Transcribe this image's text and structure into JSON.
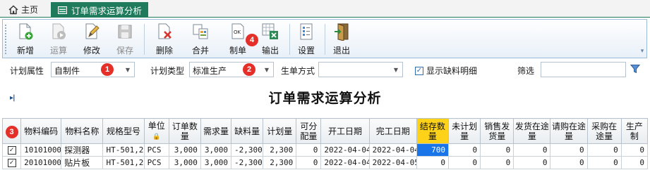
{
  "tabs": {
    "home_label": "主页",
    "active_label": "订单需求运算分析"
  },
  "toolbar": {
    "buttons": [
      {
        "label": "新增",
        "icon": "new-icon",
        "enabled": true
      },
      {
        "label": "运算",
        "icon": "compute-icon",
        "enabled": false
      },
      {
        "label": "修改",
        "icon": "edit-icon",
        "enabled": true
      },
      {
        "label": "保存",
        "icon": "save-icon",
        "enabled": false
      },
      {
        "label": "删除",
        "icon": "delete-icon",
        "enabled": true
      },
      {
        "label": "合并",
        "icon": "merge-icon",
        "enabled": true
      },
      {
        "label": "制单",
        "icon": "make-order-icon",
        "enabled": true
      },
      {
        "label": "输出",
        "icon": "export-icon",
        "enabled": true
      },
      {
        "label": "设置",
        "icon": "settings-icon",
        "enabled": true
      },
      {
        "label": "退出",
        "icon": "exit-icon",
        "enabled": true
      }
    ]
  },
  "filters": {
    "plan_attr_label": "计划属性",
    "plan_attr_value": "自制件",
    "plan_type_label": "计划类型",
    "plan_type_value": "标准生产",
    "production_mode_label": "生单方式",
    "production_mode_value": "",
    "show_shortage_label": "显示缺料明细",
    "show_shortage_checked": true,
    "filter_label": "筛选",
    "filter_value": ""
  },
  "badges": {
    "b1": "1",
    "b2": "2",
    "b3": "3",
    "b4": "4"
  },
  "report": {
    "collapse_glyph": "▸|",
    "title": "订单需求运算分析"
  },
  "grid": {
    "columns": [
      "物料编码",
      "物料名称",
      "规格型号",
      "单位",
      "订单数量",
      "需求量",
      "缺料量",
      "计划量",
      "可分配量",
      "开工日期",
      "完工日期",
      "结存数量",
      "未计划量",
      "销售发货量",
      "发货在途量",
      "请购在途量",
      "采购在途量",
      "生产制"
    ],
    "rows": [
      {
        "checked": true,
        "code": "10101000",
        "name": "探测器",
        "spec": "HT-501,2",
        "unit": "PCS",
        "order_qty": "3,000",
        "demand": "3,000",
        "shortage": "-2,300",
        "plan_qty": "2,300",
        "allocatable": "0",
        "start": "2022-04-04",
        "finish": "2022-04-04",
        "stock": "700",
        "unplanned": "0",
        "sales_ship": "0",
        "ship_transit": "0",
        "req_transit": "0",
        "po_transit": "0",
        "prod": "0"
      },
      {
        "checked": true,
        "code": "20101000",
        "name": "贴片板",
        "spec": "HT-501,2",
        "unit": "PCS",
        "order_qty": "3,000",
        "demand": "3,000",
        "shortage": "-2,300",
        "plan_qty": "2,300",
        "allocatable": "0",
        "start": "2022-04-04",
        "finish": "2022-04-05",
        "stock": "0",
        "unplanned": "0",
        "sales_ship": "0",
        "ship_transit": "0",
        "req_transit": "0",
        "po_transit": "0",
        "prod": "0"
      }
    ]
  },
  "colors": {
    "tab_active": "#1f7b5c",
    "badge": "#e5302a",
    "stock_header": "#ffd21a",
    "selection": "#1a75e8"
  }
}
